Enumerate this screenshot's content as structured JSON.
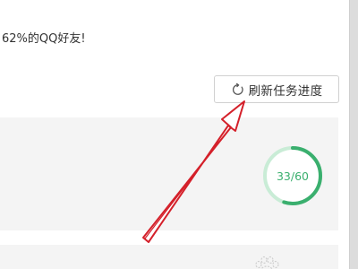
{
  "header": {
    "text": "62%的QQ好友!"
  },
  "toolbar": {
    "refresh_label": "刷新任务进度",
    "refresh_icon": "refresh-icon"
  },
  "task": {
    "progress_text": "33/60",
    "progress_fraction": 0.55,
    "accent_color": "#3aaf6e"
  },
  "icons": {
    "paw": "paw-icon",
    "annotation": "red-arrow"
  }
}
